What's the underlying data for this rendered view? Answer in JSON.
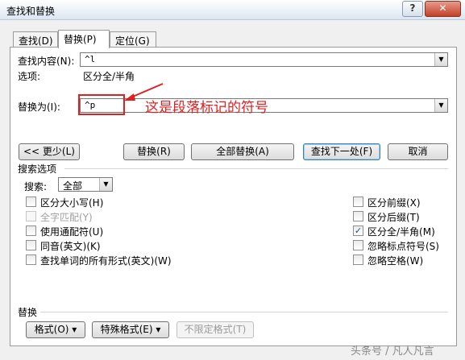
{
  "window": {
    "title": "查找和替换",
    "help_label": "?",
    "close_label": "✕"
  },
  "tabs": [
    {
      "label": "查找(D)",
      "active": false
    },
    {
      "label": "替换(P)",
      "active": true
    },
    {
      "label": "定位(G)",
      "active": false
    }
  ],
  "find": {
    "label": "查找内容(N):",
    "value": "^l"
  },
  "options": {
    "label": "选项:",
    "value": "区分全/半角"
  },
  "replace": {
    "label": "替换为(I):",
    "value": "^p"
  },
  "annotation": {
    "text": "这是段落标记的符号",
    "color": "#e02020"
  },
  "buttons": {
    "less": "<< 更少(L)",
    "replace": "替换(R)",
    "replace_all": "全部替换(A)",
    "find_next": "查找下一处(F)",
    "cancel": "取消"
  },
  "search_options": {
    "group_label": "搜索选项",
    "search_label": "搜索:",
    "search_value": "全部",
    "left": [
      {
        "label": "区分大小写(H)",
        "checked": false,
        "disabled": false
      },
      {
        "label": "全字匹配(Y)",
        "checked": false,
        "disabled": true
      },
      {
        "label": "使用通配符(U)",
        "checked": false,
        "disabled": false
      },
      {
        "label": "同音(英文)(K)",
        "checked": false,
        "disabled": false
      },
      {
        "label": "查找单词的所有形式(英文)(W)",
        "checked": false,
        "disabled": false
      }
    ],
    "right": [
      {
        "label": "区分前缀(X)",
        "checked": false,
        "disabled": false
      },
      {
        "label": "区分后缀(T)",
        "checked": false,
        "disabled": false
      },
      {
        "label": "区分全/半角(M)",
        "checked": true,
        "disabled": false
      },
      {
        "label": "忽略标点符号(S)",
        "checked": false,
        "disabled": false
      },
      {
        "label": "忽略空格(W)",
        "checked": false,
        "disabled": false
      }
    ]
  },
  "replace_section": {
    "label": "替换",
    "format": "格式(O) ▾",
    "special": "特殊格式(E) ▾",
    "no_format": "不限定格式(T)"
  },
  "watermark": "头条号 / 凡人凡言"
}
